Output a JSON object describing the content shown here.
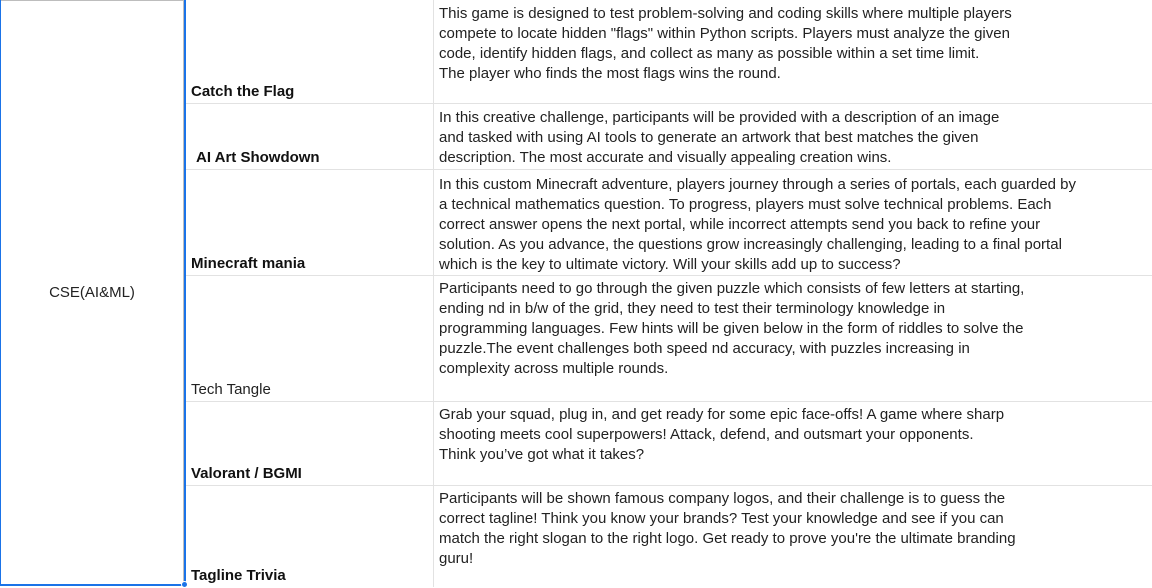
{
  "sheet": {
    "department": "CSE(AI&ML)",
    "accent_color": "#1a73e8",
    "rows": [
      {
        "name": "Catch the Flag",
        "description": "This game is designed to test problem-solving and coding skills where multiple players\ncompete to locate hidden \"flags\" within Python scripts. Players must analyze the given\ncode, identify hidden flags, and collect as many as possible within a set time limit.\nThe player who finds the most flags wins the round."
      },
      {
        "name": "AI Art Showdown",
        "description": "In this creative challenge, participants will be provided with a description of an image\nand tasked with using AI tools to generate an artwork that best matches the given\ndescription. The most accurate and visually appealing creation wins."
      },
      {
        "name": "Minecraft mania",
        "description": "In this custom Minecraft adventure, players journey through a series of portals, each guarded by\n a technical mathematics question. To progress, players must solve technical problems. Each\ncorrect answer opens the next portal, while incorrect attempts send you back to refine your\nsolution. As you advance, the questions grow increasingly challenging, leading to a final portal\nwhich is the key to ultimate victory. Will your skills add up to success?"
      },
      {
        "name": "Tech Tangle",
        "description": "Participants need to go through the given puzzle which consists of few letters at starting,\nending nd in b/w of the grid, they need to test their terminology knowledge in\nprogramming languages. Few hints will be given below in the form of riddles to solve the\npuzzle.The event challenges both speed nd accuracy, with puzzles increasing in\ncomplexity across multiple rounds."
      },
      {
        "name": "Valorant / BGMI",
        "description": "Grab your squad, plug in, and get ready for some epic face-offs! A game where sharp\nshooting meets cool superpowers! Attack, defend, and outsmart your opponents.\nThink you’ve got what it takes?"
      },
      {
        "name": "Tagline Trivia",
        "description": "Participants will be shown famous company logos, and their challenge is to guess the\ncorrect tagline! Think you know your brands? Test your knowledge and see if you can\nmatch the right slogan to the right logo. Get ready to prove you're the ultimate branding\nguru!"
      }
    ]
  }
}
